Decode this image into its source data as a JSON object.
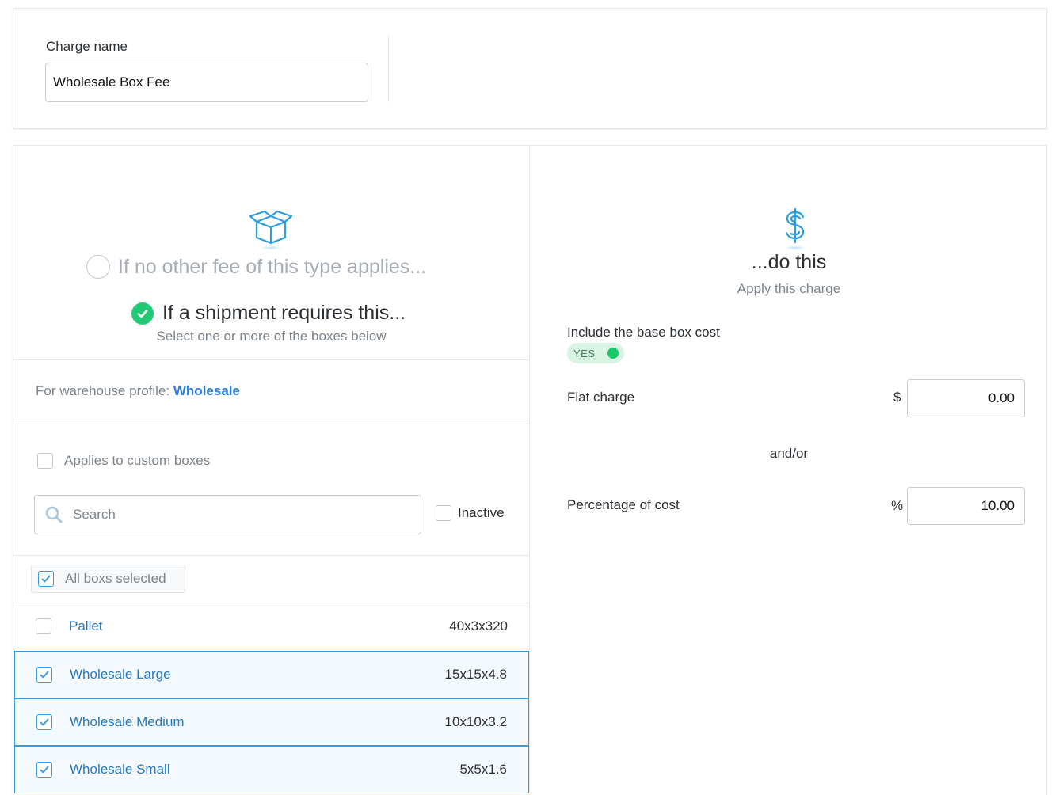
{
  "charge": {
    "label": "Charge name",
    "value": "Wholesale Box Fee"
  },
  "condition": {
    "option_no_other_fee": "If no other fee of this type applies...",
    "option_requires": "If a shipment requires this...",
    "requires_subtitle": "Select one or more of the boxes below",
    "selected_option": "requires",
    "profile_prefix": "For warehouse profile:",
    "profile_name": "Wholesale",
    "custom_boxes_label": "Applies to custom boxes",
    "custom_boxes_checked": false,
    "search_placeholder": "Search",
    "inactive_label": "Inactive",
    "inactive_checked": false,
    "all_selected_label": "All boxs selected",
    "all_selected_checked": true,
    "boxes": [
      {
        "name": "Pallet",
        "dims": "40x3x320",
        "checked": false
      },
      {
        "name": "Wholesale Large",
        "dims": "15x15x4.8",
        "checked": true
      },
      {
        "name": "Wholesale Medium",
        "dims": "10x10x3.2",
        "checked": true
      },
      {
        "name": "Wholesale Small",
        "dims": "5x5x1.6",
        "checked": true
      }
    ]
  },
  "action": {
    "title": "...do this",
    "subtitle": "Apply this charge",
    "base_cost_label": "Include the base box cost",
    "base_cost_toggle": "YES",
    "flat_charge_label": "Flat charge",
    "flat_charge_unit": "$",
    "flat_charge_value": "0.00",
    "andor": "and/or",
    "percentage_label": "Percentage of cost",
    "percentage_unit": "%",
    "percentage_value": "10.00"
  },
  "colors": {
    "accent_blue": "#2f7bd8",
    "link_blue": "#2678c0",
    "success_green": "#22c873",
    "icon_blue": "#2a9ee0"
  },
  "icons": [
    "box-icon",
    "dollar-icon",
    "search-icon",
    "check-icon",
    "radio-checked-icon"
  ]
}
